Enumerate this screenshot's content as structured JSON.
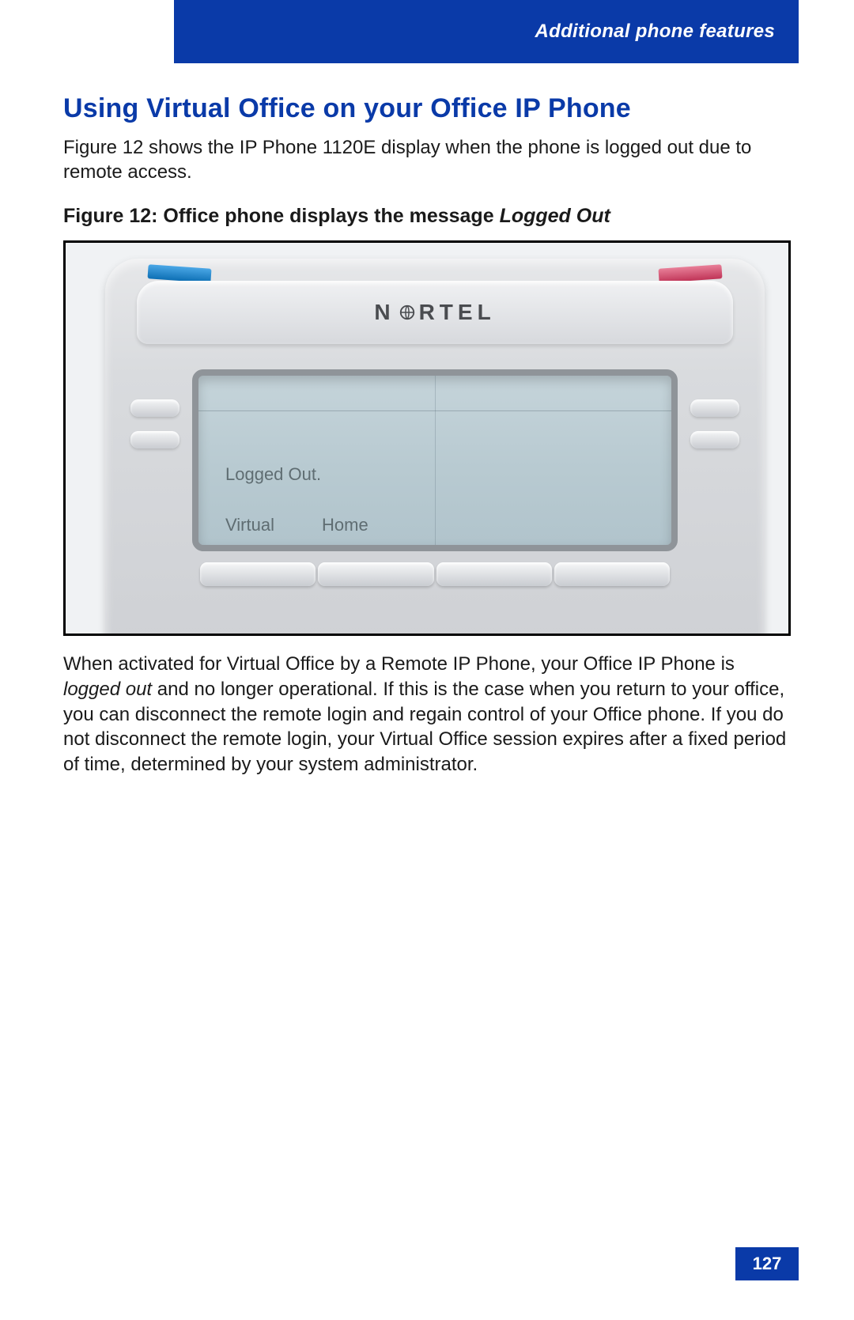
{
  "header": {
    "section_title": "Additional phone features"
  },
  "heading": "Using Virtual Office on your Office IP Phone",
  "intro": "Figure 12 shows the IP Phone 1120E display when the phone is logged out due to remote access.",
  "figure": {
    "caption_prefix": "Figure 12: Office phone displays the message ",
    "caption_italic": "Logged Out",
    "brand_left": "N",
    "brand_right": "RTEL",
    "screen": {
      "status": "Logged Out.",
      "softkey1": "Virtual",
      "softkey2": "Home"
    }
  },
  "body_paragraph": {
    "pre": "When activated for Virtual Office by a Remote IP Phone, your Office IP Phone is ",
    "italic": "logged out",
    "post": " and no longer operational. If this is the case when you return to your office, you can disconnect the remote login and regain control of your Office phone. If you do not disconnect the remote login, your Virtual Office session expires after a fixed period of time, determined by your system administrator."
  },
  "page_number": "127"
}
